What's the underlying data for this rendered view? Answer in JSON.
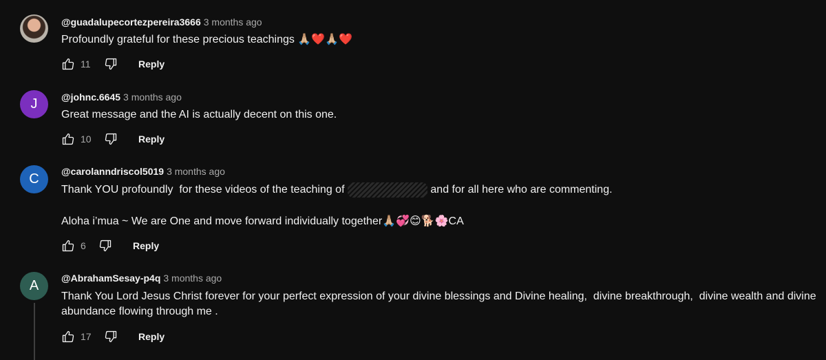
{
  "comments": [
    {
      "author": "@guadalupecortezpereira3666",
      "time": "3 months ago",
      "text": "Profoundly grateful for these precious teachings 🙏🏼❤️🙏🏼❤️",
      "likes": "11",
      "reply_label": "Reply",
      "avatar_icon": "user-photo-avatar"
    },
    {
      "author": "@johnc.6645",
      "time": "3 months ago",
      "text": "Great message and the AI is actually decent on this one.",
      "likes": "10",
      "reply_label": "Reply",
      "avatar_letter": "J",
      "avatar_color": "#7b2fbe"
    },
    {
      "author": "@carolanndriscol5019",
      "time": "3 months ago",
      "text_part1": "Thank YOU profoundly  for these videos of the teaching of ",
      "text_part2": " and for all here who are commenting.",
      "text_line2": "Aloha i’mua ~ We are One and move forward individually together🙏🏼💞😊🐕🌸CA",
      "likes": "6",
      "reply_label": "Reply",
      "avatar_letter": "C",
      "avatar_color": "#1e63b8"
    },
    {
      "author": "@AbrahamSesay-p4q",
      "time": "3 months ago",
      "text": "Thank You Lord Jesus Christ forever for your perfect expression of your divine blessings and Divine healing,  divine breakthrough,  divine wealth and divine abundance flowing through me .",
      "likes": "17",
      "reply_label": "Reply",
      "avatar_letter": "A",
      "avatar_color": "#2e5d52"
    }
  ]
}
